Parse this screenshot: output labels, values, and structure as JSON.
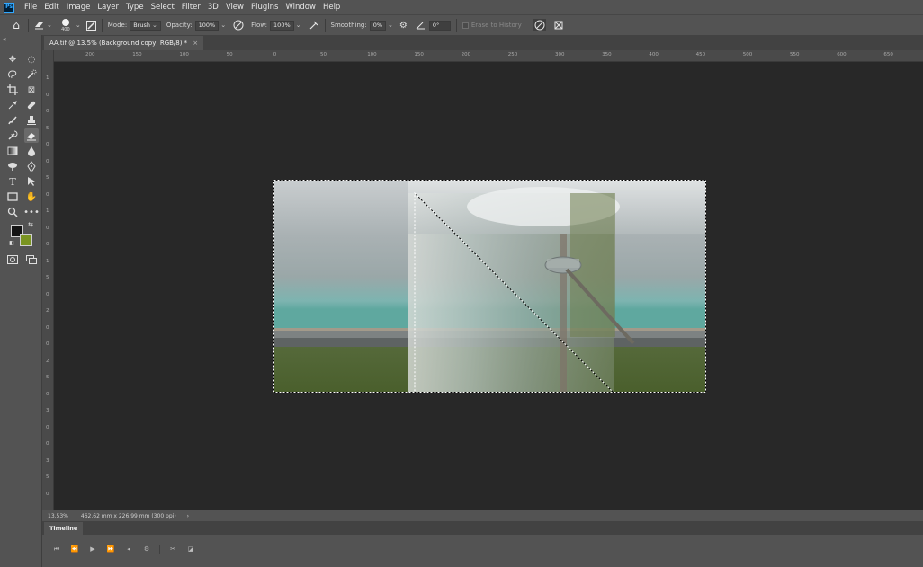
{
  "app": {
    "logo_text": "Ps"
  },
  "menu": [
    "File",
    "Edit",
    "Image",
    "Layer",
    "Type",
    "Select",
    "Filter",
    "3D",
    "View",
    "Plugins",
    "Window",
    "Help"
  ],
  "options": {
    "brush_size": "400",
    "mode_label": "Mode:",
    "mode_value": "Brush",
    "opacity_label": "Opacity:",
    "opacity_value": "100%",
    "flow_label": "Flow:",
    "flow_value": "100%",
    "smoothing_label": "Smoothing:",
    "smoothing_value": "0%",
    "angle_value": "0°",
    "erase_history_label": "Erase to History"
  },
  "document_tab": {
    "title": "AA.tif @ 13.5% (Background copy, RGB/8) *",
    "close": "×"
  },
  "ruler_h_ticks": [
    "200",
    "150",
    "100",
    "50",
    "0",
    "50",
    "100",
    "150",
    "200",
    "250",
    "300",
    "350",
    "400",
    "450",
    "500",
    "550",
    "600",
    "650"
  ],
  "ruler_v_ticks": [
    "1",
    "0",
    "0",
    "5",
    "0",
    "0",
    "5",
    "0",
    "1",
    "0",
    "0",
    "1",
    "5",
    "0",
    "2",
    "0",
    "0",
    "2",
    "5",
    "0",
    "3",
    "0",
    "0",
    "3",
    "5",
    "0"
  ],
  "status": {
    "zoom": "13.53%",
    "doc_info": "462.62 mm x 226.99 mm (300 ppi)",
    "arrow": "›"
  },
  "timeline": {
    "tab_label": "Timeline"
  },
  "colors": {
    "foreground": "#141414",
    "background": "#7a9421",
    "selection": "#ffffff"
  }
}
